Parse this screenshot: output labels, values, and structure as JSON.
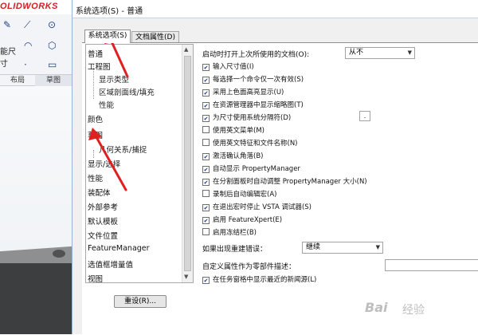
{
  "background_app": {
    "logo": "OLIDWORKS",
    "ribbon_label": "能尺\n寸",
    "tabs": [
      "布局",
      "草图"
    ]
  },
  "dialog": {
    "title": "系统选项(S) - 普通",
    "tabs": [
      {
        "label": "系统选项(S)"
      },
      {
        "label": "文档属性(D)"
      }
    ],
    "tree": [
      {
        "label": "普通"
      },
      {
        "label": "工程图"
      },
      {
        "label": "显示类型"
      },
      {
        "label": "区域剖面线/填充"
      },
      {
        "label": "性能"
      },
      {
        "label": "颜色"
      },
      {
        "label": "草图"
      },
      {
        "label": "几何关系/捕捉"
      },
      {
        "label": "显示/选择"
      },
      {
        "label": "性能"
      },
      {
        "label": "装配体"
      },
      {
        "label": "外部参考"
      },
      {
        "label": "默认模板"
      },
      {
        "label": "文件位置"
      },
      {
        "label": "FeatureManager"
      },
      {
        "label": "选值框增量值"
      },
      {
        "label": "视图"
      }
    ],
    "reset_label": "重设(R)...",
    "open_last_label": "启动时打开上次所使用的文档(O):",
    "open_last_value": "从不",
    "checkboxes": [
      {
        "label": "输入尺寸值(I)",
        "checked": "✔"
      },
      {
        "label": "每选择一个命令仅一次有效(S)",
        "checked": "✔"
      },
      {
        "label": "采用上色面高亮显示(U)",
        "checked": "✔"
      },
      {
        "label": "在资源管理器中显示缩略图(T)",
        "checked": "✔"
      },
      {
        "label": "为尺寸使用系统分隔符(D)",
        "checked": "✔"
      },
      {
        "label": "使用英文菜单(M)",
        "checked": ""
      },
      {
        "label": "使用英文特征和文件名称(N)",
        "checked": ""
      },
      {
        "label": "激活确认角落(B)",
        "checked": "✔"
      },
      {
        "label": "自动显示 PropertyManager",
        "checked": "✔"
      },
      {
        "label": "在分割面板时自动调整 PropertyManager 大小(N)",
        "checked": "✔"
      },
      {
        "label": "录制后自动编辑宏(A)",
        "checked": ""
      },
      {
        "label": "在退出宏时停止 VSTA 调试器(S)",
        "checked": "✔"
      },
      {
        "label": "启用 FeatureXpert(E)",
        "checked": "✔"
      },
      {
        "label": "启用冻结栏(B)",
        "checked": ""
      }
    ],
    "separator_value": ".",
    "rebuild_error_label": "如果出现重建错误：",
    "rebuild_error_value": "继续",
    "custom_prop_label": "自定义属性作为零部件描述：",
    "last_row_label": "在任务窗格中显示最近的新闻源(L)"
  },
  "watermark": {
    "text": "Bai",
    "sub": "经验"
  },
  "colors": {
    "annotation": "#e02020",
    "logo": "#d32020"
  }
}
